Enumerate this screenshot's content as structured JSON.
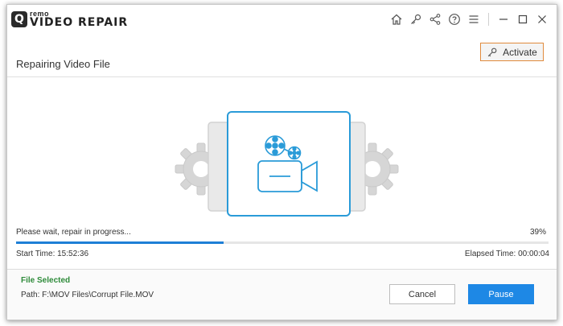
{
  "app": {
    "logo_badge": "Q",
    "logo_small": "remo",
    "logo_big": "VIDEO REPAIR"
  },
  "toolbar_icons": [
    "home-icon",
    "key-icon",
    "share-icon",
    "help-icon",
    "menu-icon",
    "minimize-icon",
    "maximize-icon",
    "close-icon"
  ],
  "header": {
    "title": "Repairing Video File",
    "activate_label": "Activate"
  },
  "progress": {
    "status_text": "Please wait, repair in progress...",
    "percent_text": "39%",
    "fraction": 0.39,
    "start_time": "Start Time:  15:52:36",
    "elapsed_time": "Elapsed Time:  00:00:04"
  },
  "footer": {
    "file_selected": "File Selected",
    "path": "Path: F:\\MOV Files\\Corrupt File.MOV",
    "cancel_label": "Cancel",
    "pause_label": "Pause"
  },
  "colors": {
    "accent": "#1e88e5",
    "progress": "#1e7fd6",
    "file_selected": "#2e8b3a",
    "activate_border": "#e08a3c",
    "illustration_blue": "#2a9bd8"
  }
}
